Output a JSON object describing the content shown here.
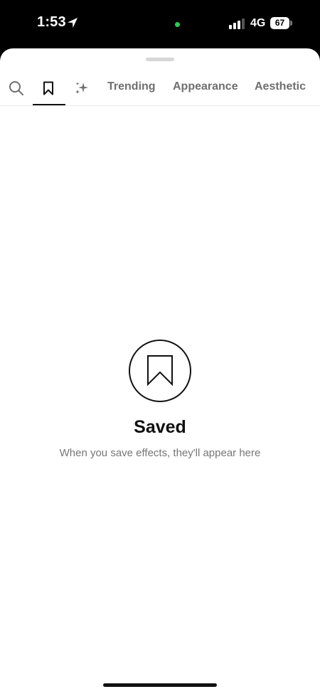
{
  "status_bar": {
    "time": "1:53",
    "network": "4G",
    "battery_level": "67",
    "privacy_dot_color": "#33c659",
    "icons": [
      "location-arrow-icon",
      "signal-bars-icon",
      "battery-icon"
    ]
  },
  "tabs": {
    "icon_tabs": [
      "search-icon",
      "bookmark-icon",
      "sparkle-icon"
    ],
    "selected": "saved",
    "trending": "Trending",
    "appearance": "Appearance",
    "aesthetic": "Aesthetic"
  },
  "empty_state": {
    "icon": "bookmark-icon",
    "title": "Saved",
    "subtitle": "When you save effects, they'll appear here"
  }
}
